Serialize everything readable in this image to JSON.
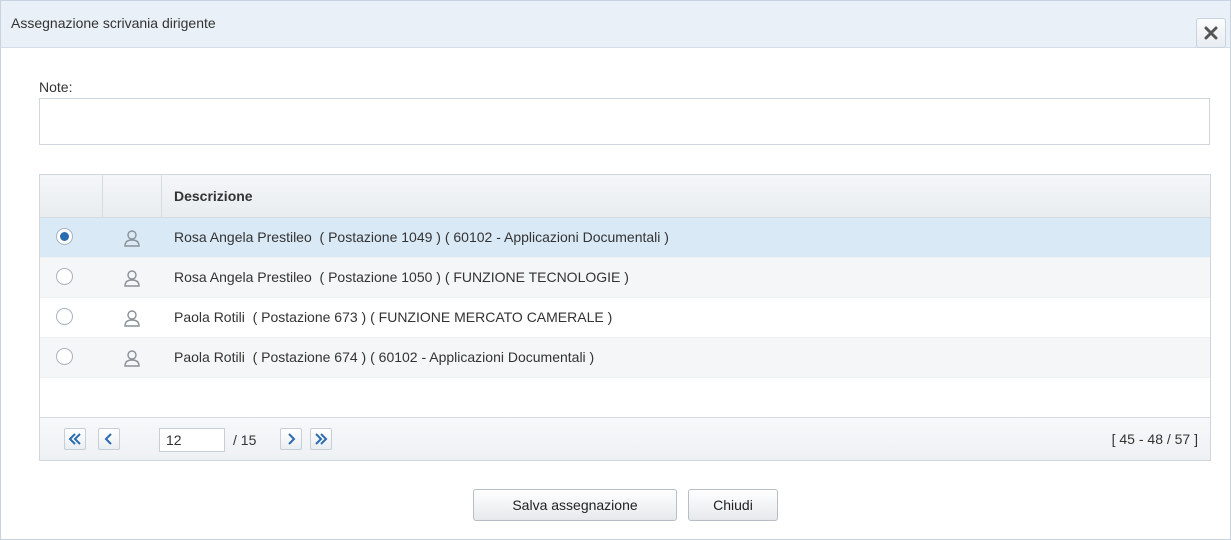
{
  "dialog": {
    "title": "Assegnazione scrivania dirigente",
    "close_icon": "close-x-icon"
  },
  "note": {
    "label": "Note:",
    "value": ""
  },
  "grid": {
    "columns": [
      "",
      "",
      "Descrizione"
    ],
    "rows": [
      {
        "selected": true,
        "icon": "user-icon",
        "text": "Rosa Angela Prestileo  ( Postazione 1049 ) ( 60102 - Applicazioni Documentali )"
      },
      {
        "selected": false,
        "icon": "user-icon",
        "text": "Rosa Angela Prestileo  ( Postazione 1050 ) ( FUNZIONE TECNOLOGIE )"
      },
      {
        "selected": false,
        "icon": "user-icon",
        "text": "Paola Rotili  ( Postazione 673 ) ( FUNZIONE MERCATO CAMERALE )"
      },
      {
        "selected": false,
        "icon": "user-icon",
        "text": "Paola Rotili  ( Postazione 674 ) ( 60102 - Applicazioni Documentali )"
      }
    ]
  },
  "pager": {
    "first_icon": "double-chevron-left-icon",
    "prev_icon": "chevron-left-icon",
    "next_icon": "chevron-right-icon",
    "last_icon": "double-chevron-right-icon",
    "current_page": "12",
    "total_pages": "/ 15",
    "range": "[ 45 - 48 / 57 ]"
  },
  "buttons": {
    "save_label": "Salva assegnazione",
    "close_label": "Chiudi"
  },
  "colors": {
    "titlebar": "#e9f0f7",
    "selected_row": "#d9e9f6",
    "pager_arrow": "#2b6cb0"
  }
}
